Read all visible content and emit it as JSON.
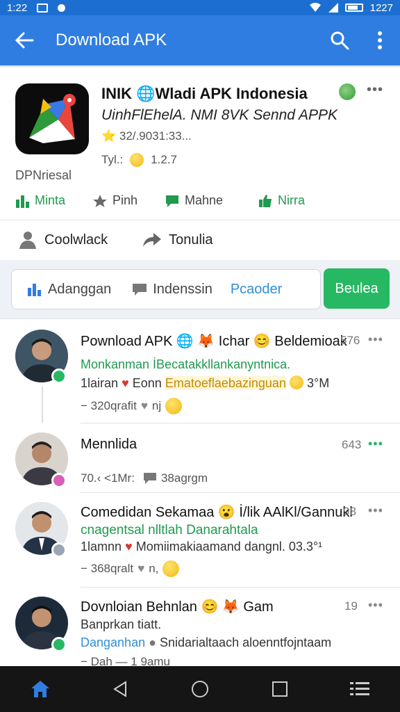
{
  "status_bar": {
    "time": "1:22",
    "right_time": "1227"
  },
  "app_bar": {
    "title": "Download APK",
    "back_icon": "arrow-left-icon",
    "search_icon": "search-icon",
    "menu_icon": "more-vertical-icon"
  },
  "app": {
    "name": "INIK 🌐Wladi APK Indonesia",
    "subtitle": "UinhFlEhelA. NMI 8VK Sennd APPK",
    "rating": "⭐ 32/.9031:33...",
    "version_label": "Tyl.:",
    "version": "1.2.7",
    "developer": "DPNriesal",
    "more": "•••",
    "stats": [
      {
        "label": "Minta",
        "icon": "chart-icon",
        "color": "#1f9a4f"
      },
      {
        "label": "Pinh",
        "icon": "star-icon",
        "color": "#444"
      },
      {
        "label": "Mahne",
        "icon": "comment-icon",
        "color": "#444"
      },
      {
        "label": "Nirra",
        "icon": "thumbs-up-icon",
        "color": "#1f9a4f"
      }
    ]
  },
  "actions": [
    {
      "label": "Coolwlack",
      "icon": "user-icon"
    },
    {
      "label": "Tonulia",
      "icon": "share-icon"
    }
  ],
  "tabs": {
    "items": [
      {
        "label": "Adanggan",
        "icon": "bar-chart-icon"
      },
      {
        "label": "Indenssin",
        "icon": "chat-icon"
      },
      {
        "label": "Pcaoder",
        "icon": ""
      }
    ],
    "button": "Beulea"
  },
  "feed": [
    {
      "title": "Pownload APK 🌐 🦊 Ichar 😊 Beldemioak",
      "count": "576",
      "line1": "Monkanman İBecatakkllankanyntnica.",
      "line2_prefix": "1lairan",
      "line2_mid": "Eonn",
      "line2_link": "Ematoeflaebazinguan",
      "line2_suffix": "3°M",
      "meta": "− 320qrafit",
      "meta2": "nj"
    },
    {
      "title": "Mennlida",
      "count": "643",
      "meta_a": "70.‹ <1Mr:",
      "meta_b": "38agrgm"
    },
    {
      "title": "Comedidan Sekamaa 😮 İ/lik AAlKl/Gannukl",
      "count": "98",
      "line1": "cnagentsal nlltlah Danarahtala",
      "line2": "1lamnn",
      "line2_rest": "Momiimakiaamand dangnl. 03.3°¹",
      "meta": "− 368qralt",
      "meta2": "n,"
    },
    {
      "title": "Dovnloian Behnlan 😊 🦊 Gam",
      "count": "19",
      "line1": "Banprkan tiatt.",
      "line2_a": "Danganhan",
      "line2_b": "Snidarialtaach aloenntfojntaam",
      "meta": "− Dah — 1 9amu"
    }
  ],
  "nav": {
    "home": "home-icon",
    "back": "back-triangle-icon",
    "circle": "home-circle-icon",
    "square": "recents-square-icon",
    "menu": "list-icon"
  },
  "colors": {
    "app_bar": "#2f7de1",
    "status_bar": "#1c6fd0",
    "accent_green": "#27b863",
    "link_blue": "#2f8fd6"
  }
}
